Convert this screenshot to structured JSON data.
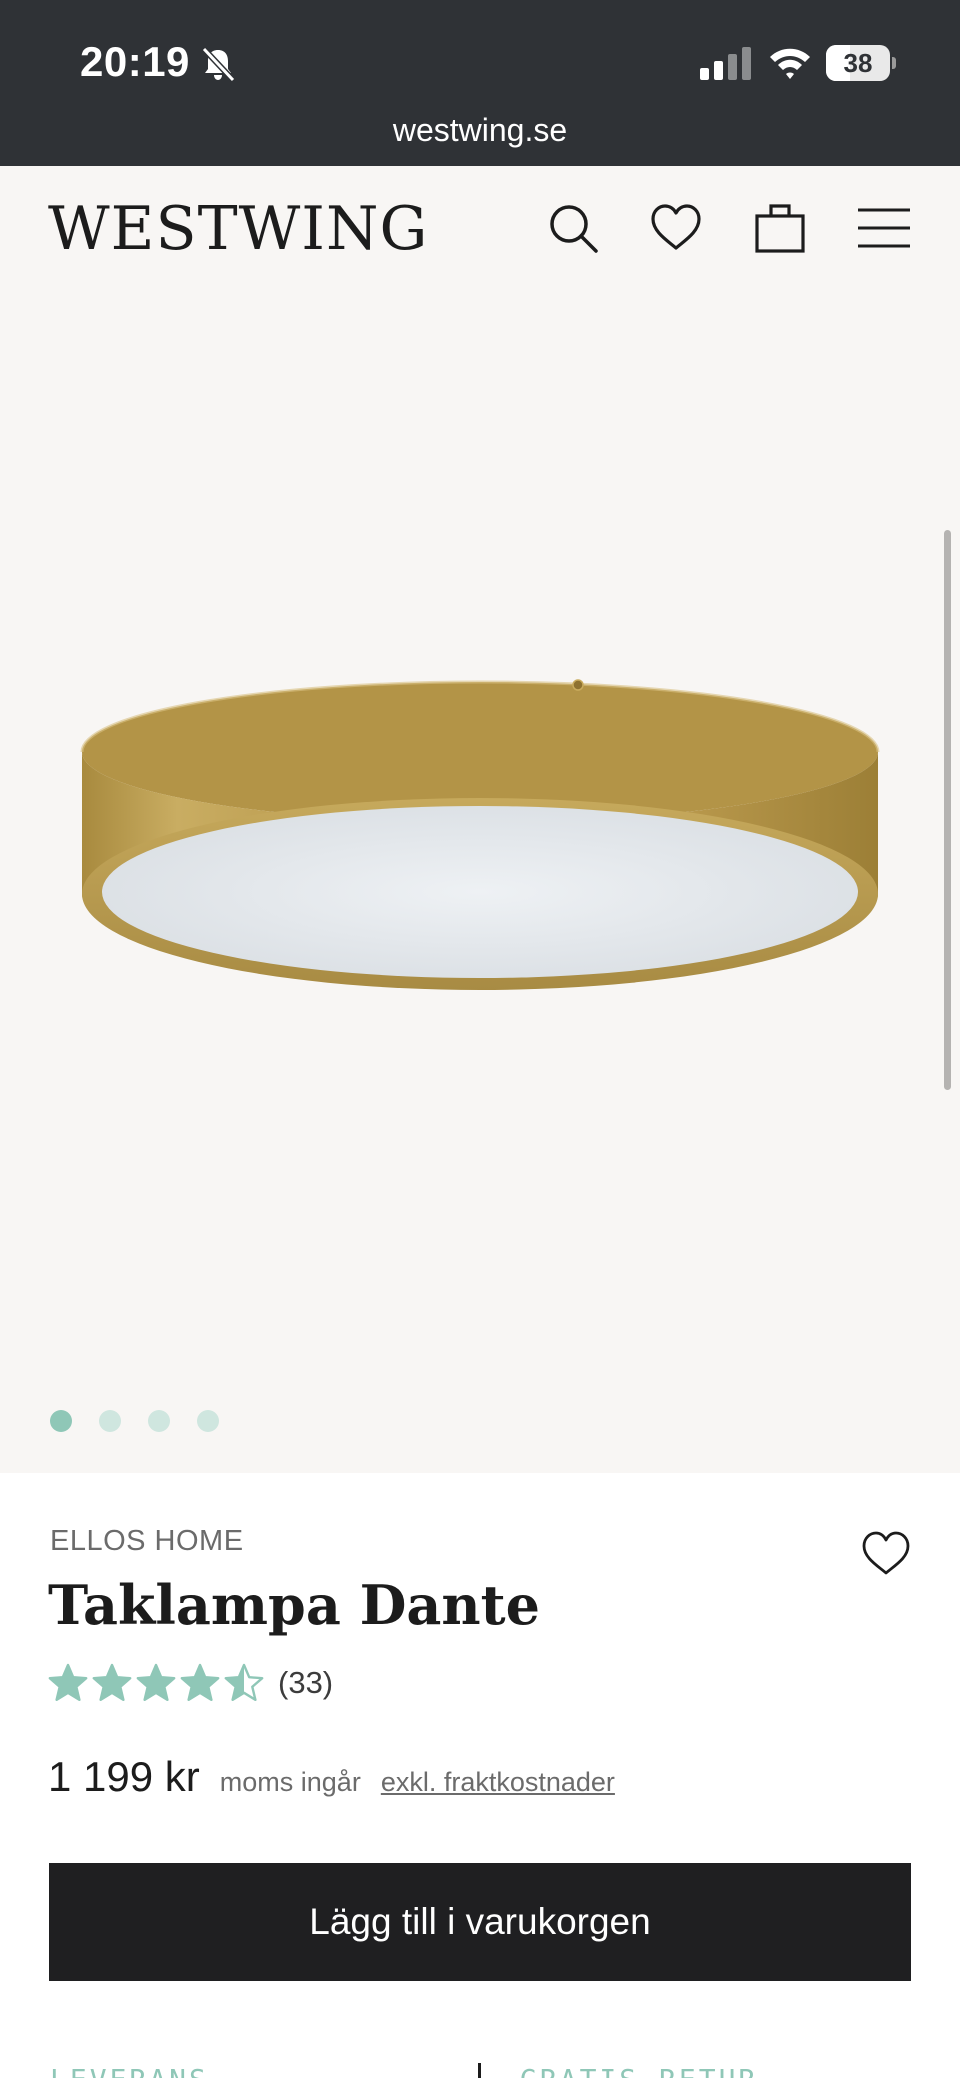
{
  "status_bar": {
    "time": "20:19",
    "battery": "38",
    "battery_level": 0.38
  },
  "browser": {
    "url": "westwing.se"
  },
  "header": {
    "logo": "WESTWING",
    "icons": [
      "search-icon",
      "heart-icon",
      "shopping-bag-icon",
      "menu-icon"
    ]
  },
  "gallery": {
    "image_count": 4,
    "active_index": 0
  },
  "product": {
    "brand": "ELLOS HOME",
    "title": "Taklampa Dante",
    "rating": 4.5,
    "rating_max": 5,
    "review_count": "(33)",
    "price": "1 199 kr",
    "vat_note": "moms ingår",
    "shipping_note": "exkl. fraktkostnader",
    "add_to_cart": "Lägg till i varukorgen"
  },
  "info_tabs": {
    "left": "LEVERANS",
    "right": "GRATIS RETUR"
  },
  "colors": {
    "accent": "#8fc7b7",
    "chrome": "#2f3236",
    "gallery_bg": "#f8f6f4",
    "button": "#1f1f21"
  }
}
